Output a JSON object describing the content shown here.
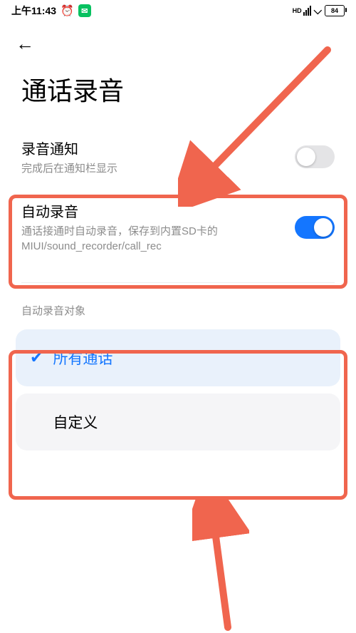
{
  "status_bar": {
    "time": "上午11:43",
    "battery": "84"
  },
  "header": {
    "back_glyph": "←",
    "title": "通话录音"
  },
  "settings": {
    "notify": {
      "title": "录音通知",
      "subtitle": "完成后在通知栏显示",
      "on": false
    },
    "auto": {
      "title": "自动录音",
      "subtitle": "通话接通时自动录音，保存到内置SD卡的MIUI/sound_recorder/call_rec",
      "on": true
    }
  },
  "section_label": "自动录音对象",
  "options": [
    {
      "label": "所有通话",
      "selected": true
    },
    {
      "label": "自定义",
      "selected": false
    }
  ],
  "annotation_color": "#f0654e"
}
